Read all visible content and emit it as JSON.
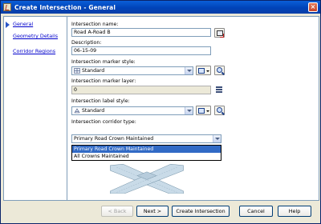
{
  "window": {
    "title": "Create Intersection - General",
    "close_label": "×"
  },
  "nav": {
    "items": [
      {
        "label": "General",
        "active": true
      },
      {
        "label": "Geometry Details",
        "active": false
      },
      {
        "label": "Corridor Regions",
        "active": false
      }
    ]
  },
  "form": {
    "intersection_name_label": "Intersection name:",
    "intersection_name_value": "Road A-Road B",
    "description_label": "Description:",
    "description_value": "06-15-09",
    "marker_style_label": "Intersection marker style:",
    "marker_style_value": "Standard",
    "marker_layer_label": "Intersection marker layer:",
    "marker_layer_value": "0",
    "label_style_label": "Intersection label style:",
    "label_style_value": "Standard",
    "corridor_type_label": "Intersection corridor type:",
    "corridor_type_value": "Primary Road Crown Maintained",
    "corridor_type_options": [
      {
        "label": "Primary Road Crown Maintained",
        "selected": true
      },
      {
        "label": "All Crowns Maintained",
        "selected": false
      }
    ]
  },
  "buttons": {
    "back": "< Back",
    "next": "Next >",
    "create": "Create Intersection",
    "cancel": "Cancel",
    "help": "Help"
  },
  "colors": {
    "titlebar": "#0043b8",
    "selection": "#316ac5",
    "link": "#0000cc"
  }
}
